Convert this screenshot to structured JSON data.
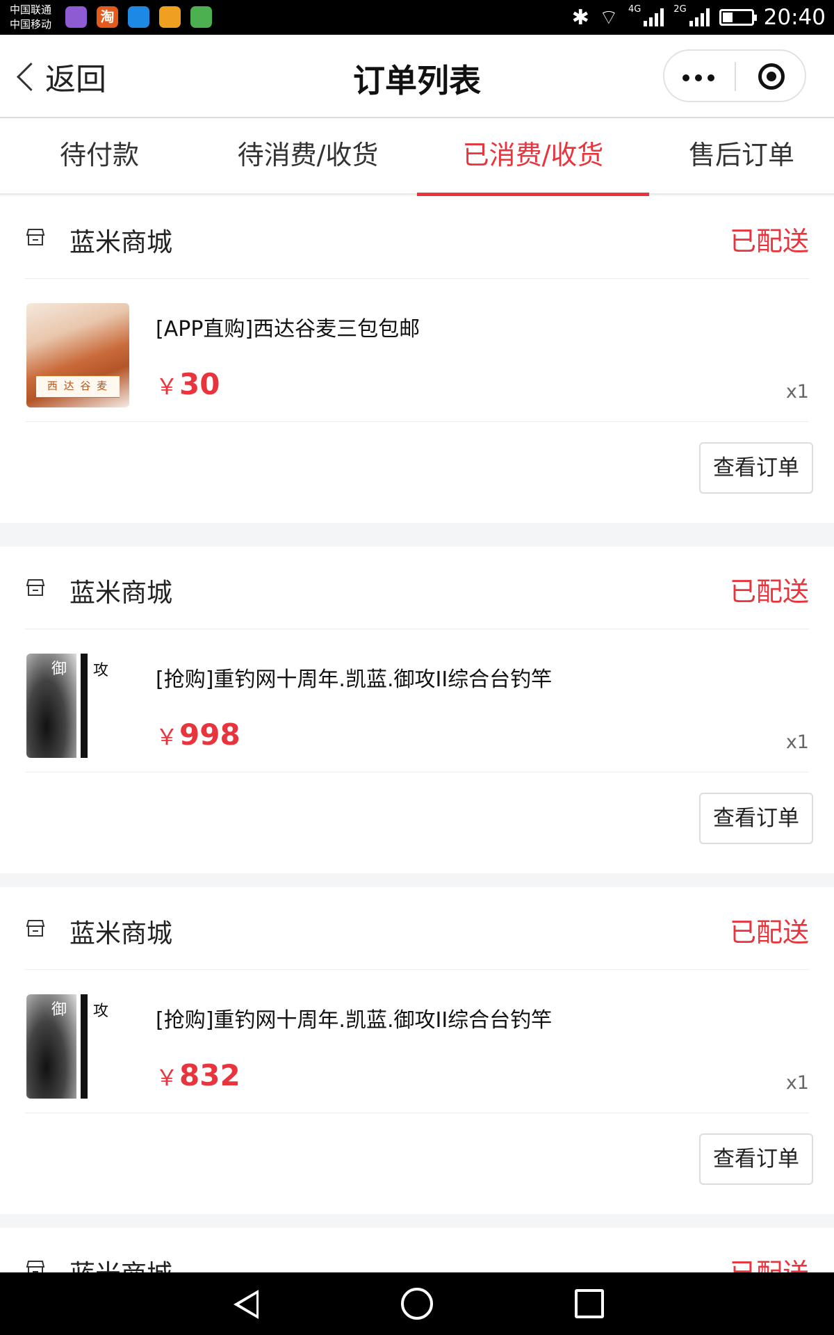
{
  "status_bar": {
    "carrier1": "中国联通",
    "carrier2": "中国移动",
    "network1": "4G",
    "network2": "2G",
    "time": "20:40",
    "app_icon_colors": [
      "#8e5bd3",
      "#e25a1c",
      "#1e88e5",
      "#f0a020",
      "#4caf50"
    ],
    "app2_glyph": "淘"
  },
  "nav": {
    "back_label": "返回",
    "title": "订单列表"
  },
  "tabs": [
    {
      "label": "待付款",
      "active": false
    },
    {
      "label": "待消费/收货",
      "active": false
    },
    {
      "label": "已消费/收货",
      "active": true
    },
    {
      "label": "售后订单",
      "active": false
    }
  ],
  "accent_color": "#e8343d",
  "orders": [
    {
      "shop": "蓝米商城",
      "status": "已配送",
      "title": "[APP直购]西达谷麦三包包邮",
      "currency": "￥",
      "price": "30",
      "qty": "x1",
      "button": "查看订单",
      "thumb_label": "西 达 谷 麦"
    },
    {
      "shop": "蓝米商城",
      "status": "已配送",
      "title": "[抢购]重钓网十周年.凯蓝.御攻II综合台钓竿",
      "currency": "￥",
      "price": "998",
      "qty": "x1",
      "button": "查看订单",
      "thumb_glyph1": "御",
      "thumb_glyph2": "攻"
    },
    {
      "shop": "蓝米商城",
      "status": "已配送",
      "title": "[抢购]重钓网十周年.凯蓝.御攻II综合台钓竿",
      "currency": "￥",
      "price": "832",
      "qty": "x1",
      "button": "查看订单",
      "thumb_glyph1": "御",
      "thumb_glyph2": "攻"
    },
    {
      "shop": "蓝米商城",
      "status": "已配送"
    }
  ]
}
